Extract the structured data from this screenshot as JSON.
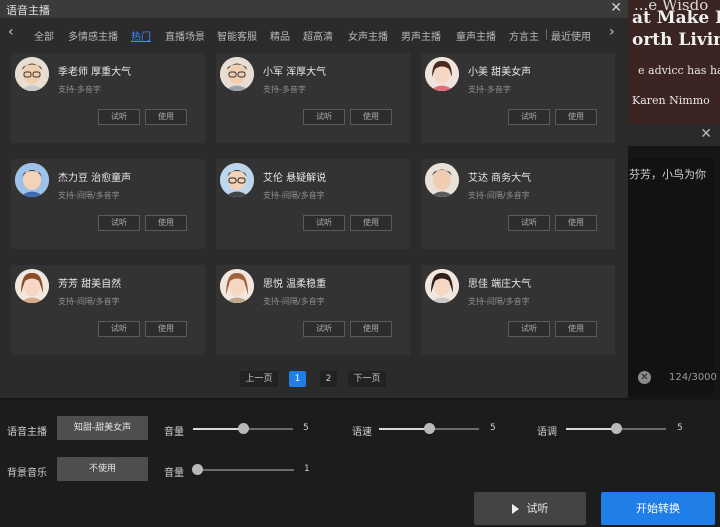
{
  "background": {
    "book_lines": [
      "...e Wisdo",
      "at Make Li",
      "orth Living",
      "e advicc has had i",
      "Karen Nimmo"
    ],
    "panel_text": "芬芳，小鸟为你",
    "panel_close": "✕",
    "clear_icon": "✕",
    "char_count": "124/3000"
  },
  "dialog": {
    "title": "语音主播",
    "close_icon": "✕",
    "tabs": [
      {
        "label": "全部"
      },
      {
        "label": "多情感主播"
      },
      {
        "label": "热门"
      },
      {
        "label": "直播场景"
      },
      {
        "label": "智能客服"
      },
      {
        "label": "精品"
      },
      {
        "label": "超高清"
      },
      {
        "label": "女声主播"
      },
      {
        "label": "男声主播"
      },
      {
        "label": "童声主播"
      },
      {
        "label": "方言主"
      },
      {
        "label": "最近使用"
      }
    ],
    "active_tab": "热门",
    "prev_icon": "‹",
    "next_icon": "›",
    "voices": [
      {
        "name": "季老师 厚重大气",
        "support": "支持-多音字",
        "avatar": "man-glasses-avatar"
      },
      {
        "name": "小军 浑厚大气",
        "support": "支持-多音字",
        "avatar": "man-glasses-avatar"
      },
      {
        "name": "小美 甜美女声",
        "support": "支持-多音字",
        "avatar": "woman-avatar"
      },
      {
        "name": "杰力豆 治愈童声",
        "support": "支持-间隔/多音字",
        "avatar": "boy-avatar"
      },
      {
        "name": "艾伦 悬疑解说",
        "support": "支持-间隔/多音字",
        "avatar": "man-glasses-avatar"
      },
      {
        "name": "艾达 商务大气",
        "support": "支持-间隔/多音字",
        "avatar": "man-avatar"
      },
      {
        "name": "芳芳 甜美自然",
        "support": "支持-间隔/多音字",
        "avatar": "woman-avatar"
      },
      {
        "name": "思悦 温柔稳重",
        "support": "支持-间隔/多音字",
        "avatar": "woman-avatar"
      },
      {
        "name": "思佳 端庄大气",
        "support": "支持-间隔/多音字",
        "avatar": "woman-avatar"
      }
    ],
    "listen_label": "试听",
    "use_label": "使用",
    "pager": {
      "prev": "上一页",
      "pages": [
        "1",
        "2"
      ],
      "current": "1",
      "next": "下一页"
    }
  },
  "controls": {
    "voice_label": "语音主播",
    "voice_value": "知甜-甜美女声",
    "volume_label": "音量",
    "volume_value": "5",
    "speed_label": "语速",
    "speed_value": "5",
    "pitch_label": "语调",
    "pitch_value": "5",
    "bgm_label": "背景音乐",
    "bgm_value": "不使用",
    "bgm_volume_label": "音量",
    "bgm_volume_value": "1",
    "slider_fractions": {
      "volume": 0.5,
      "speed": 0.5,
      "pitch": 0.5,
      "bgm_volume": 0.0
    }
  },
  "actions": {
    "listen": "试听",
    "start": "开始转换"
  },
  "colors": {
    "accent": "#1f7ee8",
    "active_tab": "#3d8bfd"
  }
}
